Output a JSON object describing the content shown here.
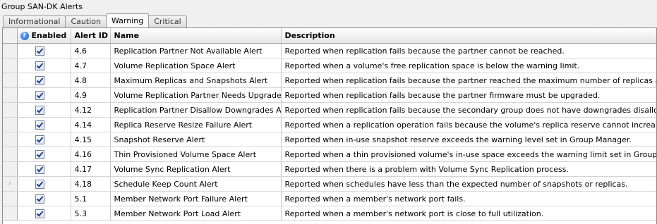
{
  "group": {
    "title": "Group SAN-DK Alerts"
  },
  "tabs": [
    {
      "label": "Informational"
    },
    {
      "label": "Caution"
    },
    {
      "label": "Warning"
    },
    {
      "label": "Critical"
    }
  ],
  "columns": {
    "enabled": "Enabled",
    "alert_id": "Alert ID",
    "name": "Name",
    "description": "Description"
  },
  "current_row_marker": "›",
  "rows": [
    {
      "enabled": true,
      "id": "4.6",
      "name": "Replication Partner Not Available Alert",
      "description": "Reported when replication fails because the partner cannot be reached."
    },
    {
      "enabled": true,
      "id": "4.7",
      "name": "Volume Replication Space Alert",
      "description": "Reported when a volume's free replication space is below the warning limit."
    },
    {
      "enabled": true,
      "id": "4.8",
      "name": "Maximum Replicas and Snapshots Alert",
      "description": "Reported when replication fails because the partner reached the maximum number of replicas and snapshots."
    },
    {
      "enabled": true,
      "id": "4.9",
      "name": "Volume Replication Partner Needs Upgrade Alert",
      "description": "Reported when replication fails because the partner firmware must be upgraded."
    },
    {
      "enabled": true,
      "id": "4.12",
      "name": "Replication Partner Disallow Downgrades Alert",
      "description": "Reported when replication fails because the secondary group does not have downgrades disallowed."
    },
    {
      "enabled": true,
      "id": "4.14",
      "name": "Replica Reserve Resize Failure Alert",
      "description": "Reported when a replication operation fails because the volume's replica reserve cannot increase."
    },
    {
      "enabled": true,
      "id": "4.15",
      "name": "Snapshot Reserve Alert",
      "description": "Reported when in-use snapshot reserve exceeds the warning level set in Group Manager."
    },
    {
      "enabled": true,
      "id": "4.16",
      "name": "Thin Provisioned Volume Space Alert",
      "description": "Reported when a thin provisioned volume's in-use space exceeds the warning limit set in Group Manager."
    },
    {
      "enabled": true,
      "id": "4.17",
      "name": "Volume Sync Replication Alert",
      "description": "Reported when there is a problem with Volume Sync Replication process."
    },
    {
      "enabled": true,
      "id": "4.18",
      "name": "Schedule Keep Count Alert",
      "description": "Reported when schedules have less than the expected number of snapshots or replicas.",
      "current": true
    },
    {
      "enabled": true,
      "id": "5.1",
      "name": "Member Network Port Failure Alert",
      "description": "Reported when a  member's network port fails."
    },
    {
      "enabled": true,
      "id": "5.3",
      "name": "Member Network Port Load Alert",
      "description": "Reported when a member's network port is close to full utilization."
    }
  ]
}
